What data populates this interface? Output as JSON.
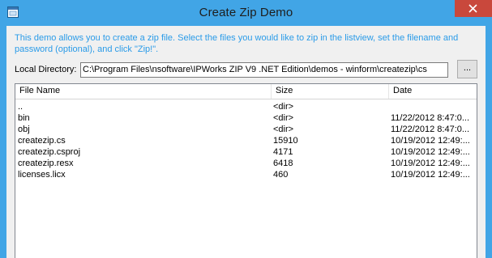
{
  "window": {
    "title": "Create Zip Demo"
  },
  "description": "This demo allows you to create a zip file. Select the files you would like to zip in the listview, set the filename and password (optional), and click \"Zip!\".",
  "directory": {
    "label": "Local Directory:",
    "value": "C:\\Program Files\\nsoftware\\IPWorks ZIP V9 .NET Edition\\demos - winform\\createzip\\cs",
    "browse_label": "..."
  },
  "listview": {
    "columns": [
      "File Name",
      "Size",
      "Date"
    ],
    "rows": [
      {
        "name": "..",
        "size": "<dir>",
        "date": ""
      },
      {
        "name": "bin",
        "size": "<dir>",
        "date": "11/22/2012 8:47:0..."
      },
      {
        "name": "obj",
        "size": "<dir>",
        "date": "11/22/2012 8:47:0..."
      },
      {
        "name": "createzip.cs",
        "size": "15910",
        "date": "10/19/2012 12:49:..."
      },
      {
        "name": "createzip.csproj",
        "size": "4171",
        "date": "10/19/2012 12:49:..."
      },
      {
        "name": "createzip.resx",
        "size": "6418",
        "date": "10/19/2012 12:49:..."
      },
      {
        "name": "licenses.licx",
        "size": "460",
        "date": "10/19/2012 12:49:..."
      }
    ]
  },
  "colors": {
    "titlebar": "#41a5e6",
    "close_button": "#c9483c",
    "description_text": "#2a9be8"
  },
  "icons": {
    "app": "app-window-icon",
    "close": "close-icon"
  }
}
